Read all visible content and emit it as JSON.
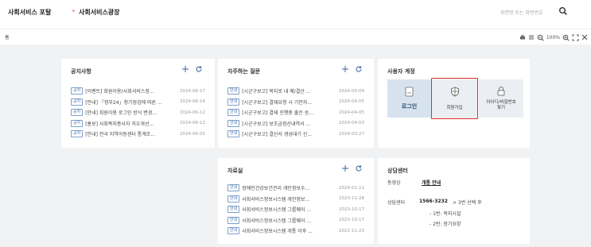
{
  "header": {
    "brand": "사회서비스 포탈",
    "breadcrumb_current": "사회서비스광장",
    "screen_search_placeholder": "화면명 또는 화면번호",
    "icons": {
      "search": "search-icon"
    }
  },
  "tabbar": {
    "home_label": "홈",
    "zoom_level": "100%",
    "icons": [
      "print-icon",
      "list-icon",
      "zoom-out-icon",
      "zoom-in-icon",
      "fullscreen-icon",
      "close-icon"
    ]
  },
  "notice": {
    "title": "공지사항",
    "items": [
      {
        "badge": "공지",
        "title": "[이벤트] 회원이용(사회서비스정...",
        "date": "2024-06-17"
      },
      {
        "badge": "공지",
        "title": "[안내] 「정부24」청기정검에 따른 ...",
        "date": "2024-06-14"
      },
      {
        "badge": "공지",
        "title": "[안내] 회원이용 로그인 방식 변경...",
        "date": "2024-06-12"
      },
      {
        "badge": "공지",
        "title": "[홍보] 사회복지종사자 처우개선...",
        "date": "2024-06-12"
      },
      {
        "badge": "공지",
        "title": "[안내] 전국 지역아동센터 통계조...",
        "date": "2024-06-05"
      }
    ]
  },
  "faq": {
    "title": "자주하는 질문",
    "items": [
      {
        "badge": "안내",
        "title": "[시군구보고] 복지로 내 예/결산 ...",
        "date": "2024-05-09"
      },
      {
        "badge": "안내",
        "title": "[시군구보고] 결재요청 시 기안자...",
        "date": "2024-04-05"
      },
      {
        "badge": "안내",
        "title": "[시군구보고] 결재 진행중 출은 승...",
        "date": "2024-04-05"
      },
      {
        "badge": "안내",
        "title": "[시군구보고] 보조금정산내역서 ...",
        "date": "2024-04-03"
      },
      {
        "badge": "안내",
        "title": "[시군구보고] 결산서 생성대기 신...",
        "date": "2024-03-27"
      }
    ]
  },
  "account": {
    "title": "사용자 계정",
    "login_label": "로그인",
    "signup_label": "회원가입",
    "find_label_line1": "아이디/비밀번호",
    "find_label_line2": "찾기",
    "login_bg": "#d6e3ee",
    "highlight_color": "#e0312c"
  },
  "archive": {
    "title": "자료실",
    "items": [
      {
        "badge": "안내",
        "title": "장애인건강보건관리 개인정보수...",
        "date": "2024-01-11"
      },
      {
        "badge": "안내",
        "title": "사회서비스정보시스템 개인정보...",
        "date": "2023-11-28"
      },
      {
        "badge": "안내",
        "title": "사회서비스정보시스템 그룹웨어 ...",
        "date": "2023-10-17"
      },
      {
        "badge": "안내",
        "title": "사회서비스정보시스템 그룹웨어 ...",
        "date": "2023-10-17"
      },
      {
        "badge": "안내",
        "title": "사회서비스정보시스템 개통 이후 ...",
        "date": "2022-11-23"
      }
    ]
  },
  "consult": {
    "title": "상담센터",
    "video_label": "동영상",
    "video_link": "개통 안내",
    "center_label": "상담센터",
    "phone": "1566-3232",
    "phone_tail": "> 3번 선택 후",
    "option1": "- 1번: 복지시설",
    "option2": "- 2번: 장기요양"
  }
}
